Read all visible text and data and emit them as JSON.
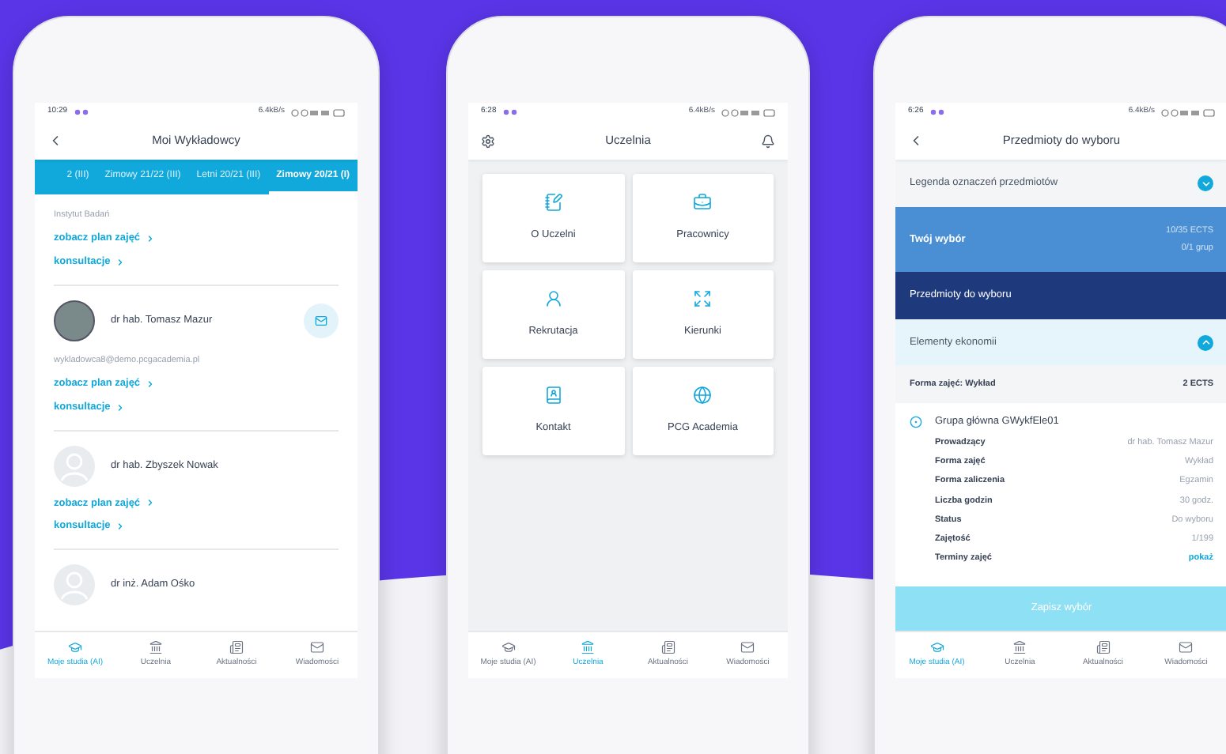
{
  "phones": [
    {
      "kind": "lecturers",
      "status_time": "10:29",
      "net_speed": "6.4kB/s",
      "title": "Moi Wykładowcy",
      "tabs": [
        {
          "label": "2 (III)",
          "selected": false
        },
        {
          "label": "Zimowy 21/22 (III)",
          "selected": false
        },
        {
          "label": "Letni 20/21 (III)",
          "selected": false
        },
        {
          "label": "Zimowy 20/21 (I)",
          "selected": true
        }
      ],
      "lecturers": [
        {
          "institute": "Instytut Badań",
          "links": [
            "zobacz plan zajęć",
            "konsultacje"
          ]
        },
        {
          "name": "dr hab. Tomasz  Mazur",
          "kind": "photo",
          "mail_button": true,
          "email": "wykladowca8@demo.pcgacademia.pl",
          "links": [
            "zobacz plan zajęć",
            "konsultacje"
          ]
        },
        {
          "name": "dr hab. Zbyszek Nowak",
          "kind": "placeholder",
          "mail_button": false,
          "links": [
            "zobacz plan zajęć",
            "konsultacje"
          ]
        },
        {
          "name": "dr inż. Adam Ośko",
          "kind": "placeholder",
          "mail_button": false
        }
      ],
      "bottom_nav": [
        {
          "label": "Moje studia (AI)",
          "selected": true
        },
        {
          "label": "Uczelnia",
          "selected": false
        },
        {
          "label": "Aktualności",
          "selected": false
        },
        {
          "label": "Wiadomości",
          "selected": false
        }
      ]
    },
    {
      "kind": "university",
      "status_time": "6:28",
      "net_speed": "6.4kB/s",
      "title": "Uczelnia",
      "tiles": [
        {
          "label": "O Uczelni"
        },
        {
          "label": "Pracownicy"
        },
        {
          "label": "Rekrutacja"
        },
        {
          "label": "Kierunki"
        },
        {
          "label": "Kontakt"
        },
        {
          "label": "PCG Academia"
        }
      ],
      "bottom_nav": [
        {
          "label": "Moje studia (AI)",
          "selected": false
        },
        {
          "label": "Uczelnia",
          "selected": true
        },
        {
          "label": "Aktualności",
          "selected": false
        },
        {
          "label": "Wiadomości",
          "selected": false
        }
      ]
    },
    {
      "kind": "electives",
      "status_time": "6:26",
      "net_speed": "6.4kB/s",
      "title": "Przedmioty do wyboru",
      "legend": {
        "label": "Legenda oznaczeń przedmiotów",
        "expanded": false
      },
      "choice": {
        "label": "Twój wybór",
        "ects": "10/35 ECTS",
        "groups": "0/1 grup"
      },
      "section_bar": "Przedmioty do wyboru",
      "subject": {
        "label": "Elementy ekonomii",
        "expanded": true
      },
      "form_row": {
        "label": "Forma zajęć: Wykład",
        "value": "2 ECTS"
      },
      "group": {
        "title": "Grupa główna GWykfEle01",
        "details": [
          {
            "label": "Prowadzący",
            "value": "dr hab. Tomasz  Mazur",
            "kind": "text"
          },
          {
            "label": "Forma zajęć",
            "value": "Wykład",
            "kind": "text"
          },
          {
            "label": "Forma zaliczenia",
            "value": "Egzamin",
            "kind": "text"
          },
          {
            "label": "Liczba godzin",
            "value": "30 godz.",
            "kind": "text"
          },
          {
            "label": "Status",
            "value": "Do wyboru",
            "kind": "text"
          },
          {
            "label": "Zajętość",
            "value": "1/199",
            "kind": "text"
          },
          {
            "label": "Terminy zajęć",
            "value": "pokaż",
            "kind": "link"
          }
        ]
      },
      "save_button": {
        "label": "Zapisz wybór",
        "disabled": true
      },
      "bottom_nav": [
        {
          "label": "Moje studia (AI)",
          "selected": true
        },
        {
          "label": "Uczelnia",
          "selected": false
        },
        {
          "label": "Aktualności",
          "selected": false
        },
        {
          "label": "Wiadomości",
          "selected": false
        }
      ]
    }
  ]
}
